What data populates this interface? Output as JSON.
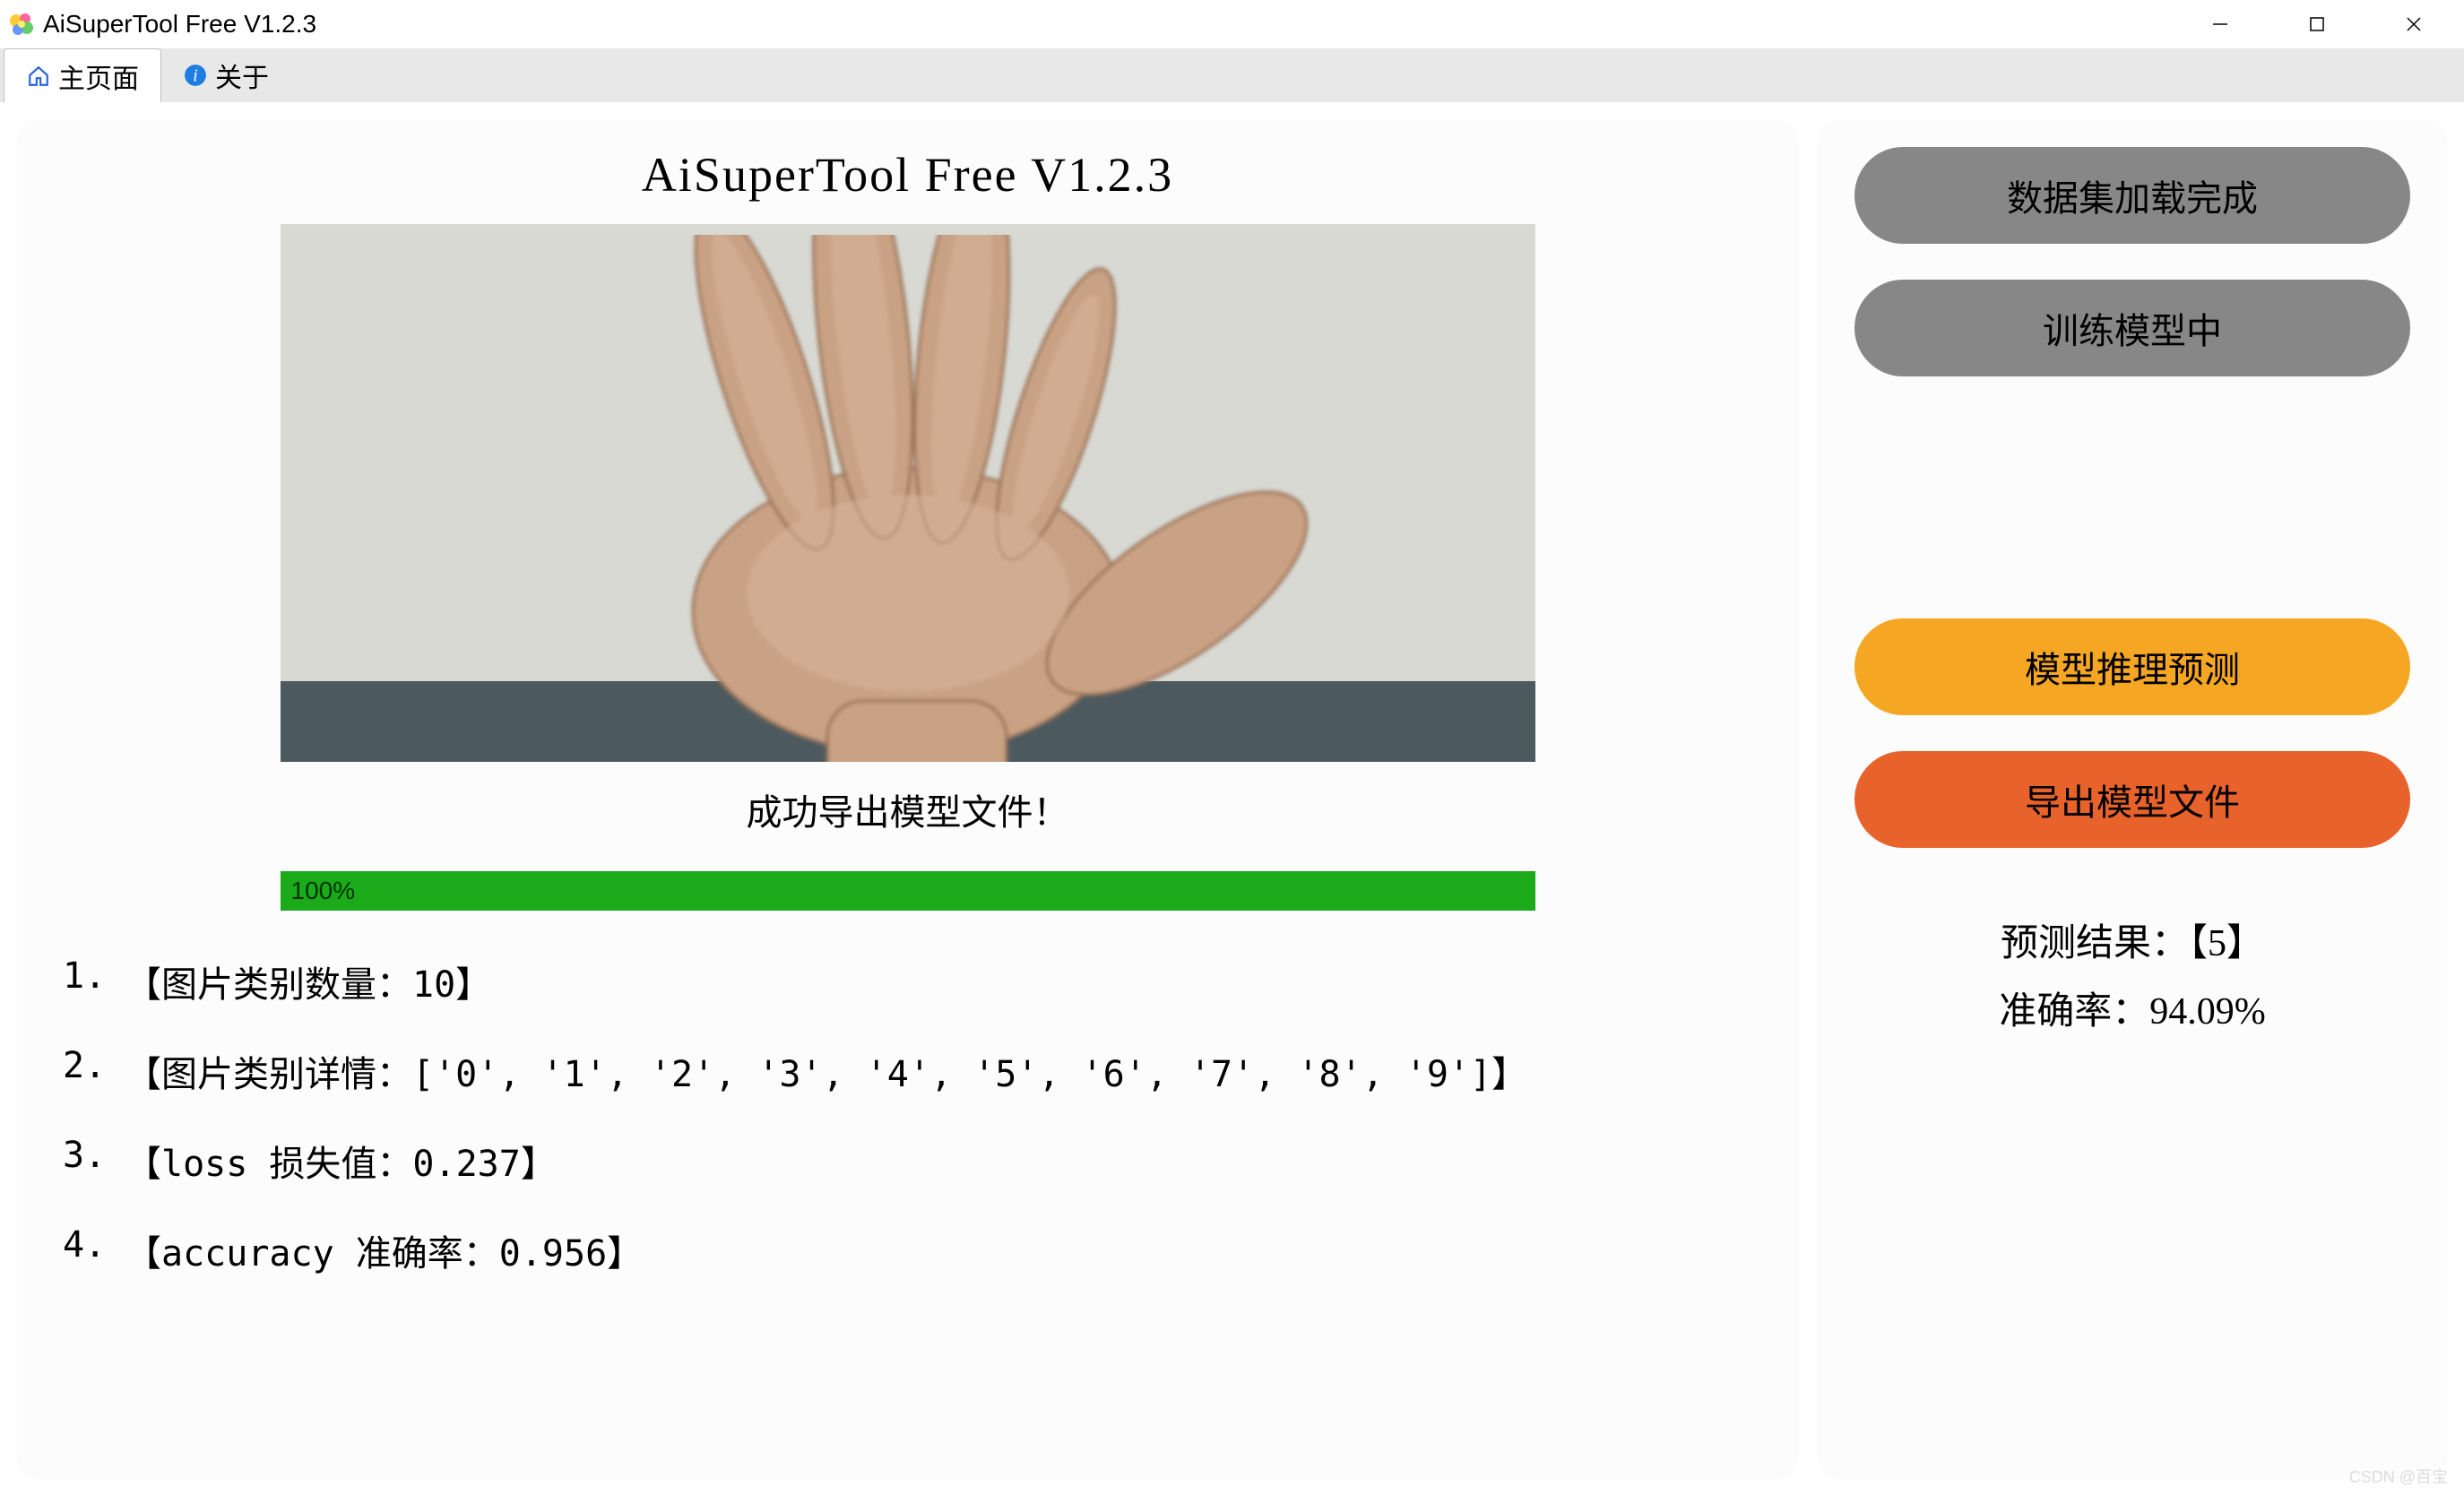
{
  "window": {
    "title": "AiSuperTool Free V1.2.3"
  },
  "tabs": {
    "home": "主页面",
    "about": "关于"
  },
  "main": {
    "title": "AiSuperTool Free V1.2.3",
    "status_text": "成功导出模型文件！",
    "progress_label": "100%",
    "logs": [
      {
        "num": "1.",
        "text": "【图片类别数量：10】"
      },
      {
        "num": "2.",
        "text": "【图片类别详情：['0', '1', '2', '3', '4', '5', '6', '7', '8', '9']】"
      },
      {
        "num": "3.",
        "text": "【loss 损失值：0.237】"
      },
      {
        "num": "4.",
        "text": "【accuracy 准确率：0.956】"
      }
    ]
  },
  "side": {
    "btn_load": "数据集加载完成",
    "btn_train": "训练模型中",
    "btn_predict": "模型推理预测",
    "btn_export": "导出模型文件",
    "result_label": "预测结果：【5】",
    "accuracy_label": "准确率：94.09%"
  },
  "watermark": "CSDN @百宝"
}
